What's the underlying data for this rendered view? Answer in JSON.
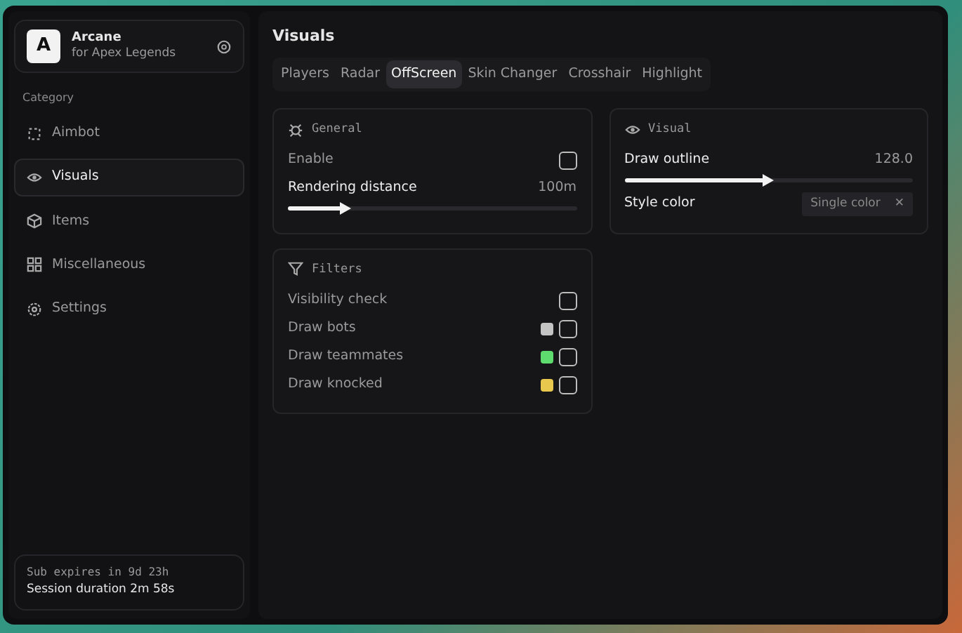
{
  "brand": {
    "logo": "A",
    "title": "Arcane",
    "subtitle": "for Apex Legends"
  },
  "sidebar": {
    "heading": "Category",
    "items": [
      {
        "label": "Aimbot",
        "selected": false
      },
      {
        "label": "Visuals",
        "selected": true
      },
      {
        "label": "Items",
        "selected": false
      },
      {
        "label": "Miscellaneous",
        "selected": false
      },
      {
        "label": "Settings",
        "selected": false
      }
    ]
  },
  "footer": {
    "line_1": "Sub expires in 9d 23h",
    "line_2": "Session duration 2m 58s"
  },
  "page_title": "Visuals",
  "tabs": [
    {
      "label": "Players",
      "selected": false
    },
    {
      "label": "Radar",
      "selected": false
    },
    {
      "label": "OffScreen",
      "selected": true
    },
    {
      "label": "Skin Changer",
      "selected": false
    },
    {
      "label": "Crosshair",
      "selected": false
    },
    {
      "label": "Highlight",
      "selected": false
    }
  ],
  "columns": [
    [
      {
        "title": "General",
        "rows": [
          {
            "kind": "checkbox",
            "label": "Enable",
            "checked": false
          },
          {
            "kind": "slider",
            "label": "Rendering distance",
            "reading": "100m",
            "level": 0.2
          }
        ]
      },
      {
        "title": "Filters",
        "rows": [
          {
            "kind": "checkbox",
            "label": "Visibility check",
            "checked": false
          },
          {
            "kind": "checkbox",
            "label": "Draw bots",
            "checked": false,
            "color": "#c4c4c4"
          },
          {
            "kind": "checkbox",
            "label": "Draw teammates",
            "checked": false,
            "color": "#5fdc6e"
          },
          {
            "kind": "checkbox",
            "label": "Draw knocked",
            "checked": false,
            "color": "#e8c94e"
          }
        ]
      }
    ],
    [
      {
        "title": "Visual",
        "rows": [
          {
            "kind": "slider",
            "label": "Draw outline",
            "reading": "128.0",
            "level": 0.5
          },
          {
            "kind": "select",
            "label": "Style color",
            "value": "Single color",
            "clear": "✕"
          }
        ]
      }
    ]
  ]
}
